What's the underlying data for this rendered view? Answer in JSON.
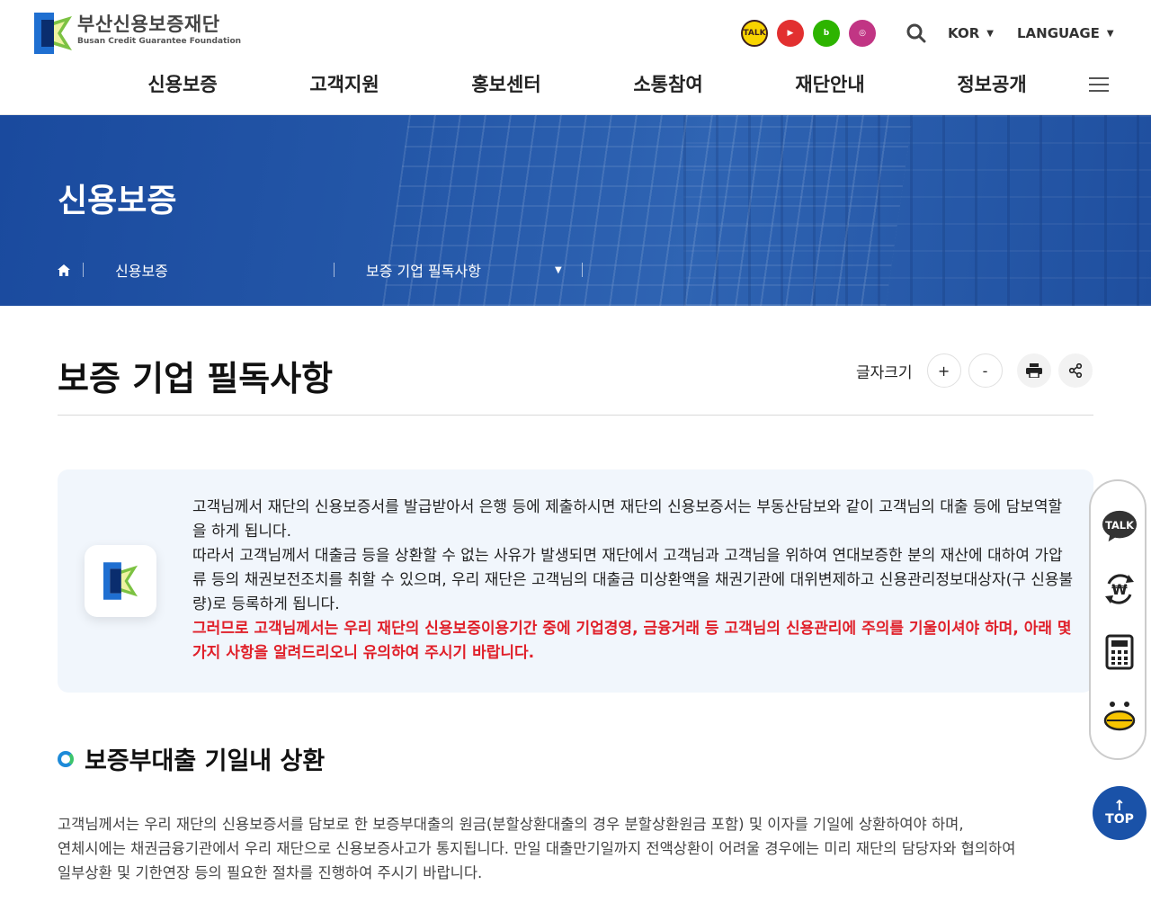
{
  "header": {
    "logo_kr": "부산신용보증재단",
    "logo_en": "Busan Credit Guarantee Foundation",
    "sns": {
      "kakao": "TALK",
      "youtube": "▶",
      "blog": "b",
      "instagram": "◎"
    },
    "lang_current": "KOR",
    "lang_menu": "LANGUAGE"
  },
  "gnb": [
    "신용보증",
    "고객지원",
    "홍보센터",
    "소통참여",
    "재단안내",
    "정보공개"
  ],
  "banner": {
    "title": "신용보증",
    "breadcrumb": [
      "신용보증",
      "보증 기업 필독사항"
    ]
  },
  "page": {
    "title": "보증 기업 필독사항",
    "font_size_label": "글자크기",
    "font_plus": "+",
    "font_minus": "-"
  },
  "info": {
    "p1": "고객님께서 재단의 신용보증서를 발급받아서 은행 등에 제출하시면 재단의 신용보증서는 부동산담보와 같이 고객님의 대출 등에 담보역할을 하게 됩니다.",
    "p2": "따라서 고객님께서 대출금 등을 상환할 수 없는 사유가 발생되면 재단에서 고객님과 고객님을 위하여 연대보증한 분의 재산에 대하여 가압류 등의 채권보전조치를 취할 수 있으며, 우리 재단은 고객님의 대출금 미상환액을 채권기관에 대위변제하고 신용관리정보대상자(구 신용불량)로 등록하게 됩니다.",
    "p3": "그러므로 고객님께서는 우리 재단의 신용보증이용기간 중에 기업경영, 금융거래 등 고객님의 신용관리에 주의를 기울이셔야 하며, 아래 몇가지 사항을 알려드리오니 유의하여 주시기 바랍니다."
  },
  "section": {
    "title": "보증부대출 기일내 상환",
    "body1": "고객님께서는 우리 재단의 신용보증서를 담보로 한 보증부대출의 원금(분할상환대출의 경우 분할상환원금 포함) 및 이자를 기일에 상환하여야 하며,",
    "body2": "연체시에는 채권금융기관에서 우리 재단으로 신용보증사고가 통지됩니다. 만일 대출만기일까지 전액상환이 어려울 경우에는 미리 재단의 담당자와 협의하여",
    "body3": "일부상환 및 기한연장 등의 필요한 절차를 진행하여 주시기 바랍니다."
  },
  "quick": {
    "talk": "TALK",
    "top": "TOP"
  },
  "colors": {
    "brand": "#1a52a8",
    "accent_red": "#e0202a",
    "banner": "#2457a8"
  }
}
